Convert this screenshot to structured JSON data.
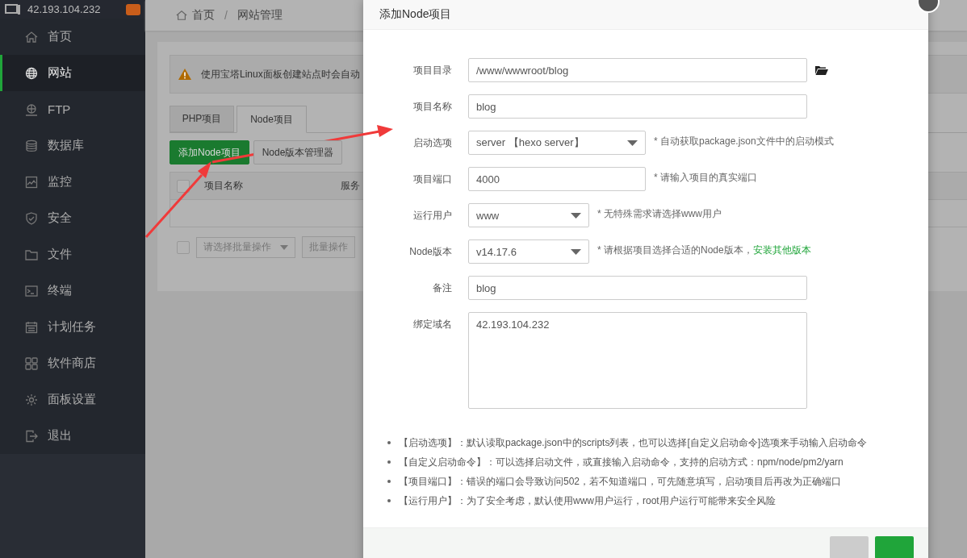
{
  "sidebar": {
    "host": "42.193.104.232",
    "items": [
      {
        "label": "首页",
        "selected": false
      },
      {
        "label": "网站",
        "selected": true
      },
      {
        "label": "FTP",
        "selected": false
      },
      {
        "label": "数据库",
        "selected": false
      },
      {
        "label": "监控",
        "selected": false
      },
      {
        "label": "安全",
        "selected": false
      },
      {
        "label": "文件",
        "selected": false
      },
      {
        "label": "终端",
        "selected": false
      },
      {
        "label": "计划任务",
        "selected": false
      },
      {
        "label": "软件商店",
        "selected": false
      },
      {
        "label": "面板设置",
        "selected": false
      },
      {
        "label": "退出",
        "selected": false
      }
    ]
  },
  "breadcrumb": [
    "首页",
    "/",
    "网站管理"
  ],
  "notice": "使用宝塔Linux面板创建站点时会自动",
  "tabs": [
    {
      "label": "PHP项目",
      "selected": false
    },
    {
      "label": "Node项目",
      "selected": true
    }
  ],
  "toolbar_buttons": [
    {
      "label": "添加Node项目",
      "kind": "primary"
    },
    {
      "label": "Node版本管理器",
      "kind": "default"
    }
  ],
  "table": {
    "select_all": {
      "checked": false
    },
    "columns": [
      "项目名称",
      "服务"
    ]
  },
  "batch": {
    "checked": false,
    "placeholder": "请选择批量操作",
    "button": "批量操作"
  },
  "dialog": {
    "title": "添加Node项目",
    "fields": [
      {
        "label": "项目目录",
        "kind": "path",
        "value": "/www/wwwroot/blog"
      },
      {
        "label": "项目名称",
        "kind": "text",
        "value": "blog"
      },
      {
        "label": "启动选项",
        "kind": "select",
        "value": "server 【hexo server】",
        "hint": "* 自动获取package.json文件中的启动模式"
      },
      {
        "label": "项目端口",
        "kind": "short",
        "value": "4000",
        "hint": "* 请输入项目的真实端口"
      },
      {
        "label": "运行用户",
        "kind": "select-small",
        "value": "www",
        "hint": "* 无特殊需求请选择www用户"
      },
      {
        "label": "Node版本",
        "kind": "select-small",
        "value": "v14.17.6",
        "hint": "* 请根据项目选择合适的Node版本，",
        "link": "安装其他版本"
      },
      {
        "label": "备注",
        "kind": "text",
        "value": "blog"
      },
      {
        "label": "绑定域名",
        "kind": "textarea",
        "value": "42.193.104.232"
      }
    ],
    "notes": [
      "【启动选项】：默认读取package.json中的scripts列表，也可以选择[自定义启动命令]选项来手动输入启动命令",
      "【自定义启动命令】：可以选择启动文件，或直接输入启动命令，支持的启动方式：npm/node/pm2/yarn",
      "【项目端口】：错误的端口会导致访问502，若不知道端口，可先随意填写，启动项目后再改为正确端口",
      "【运行用户】：为了安全考虑，默认使用www用户运行，root用户运行可能带来安全风险"
    ]
  }
}
